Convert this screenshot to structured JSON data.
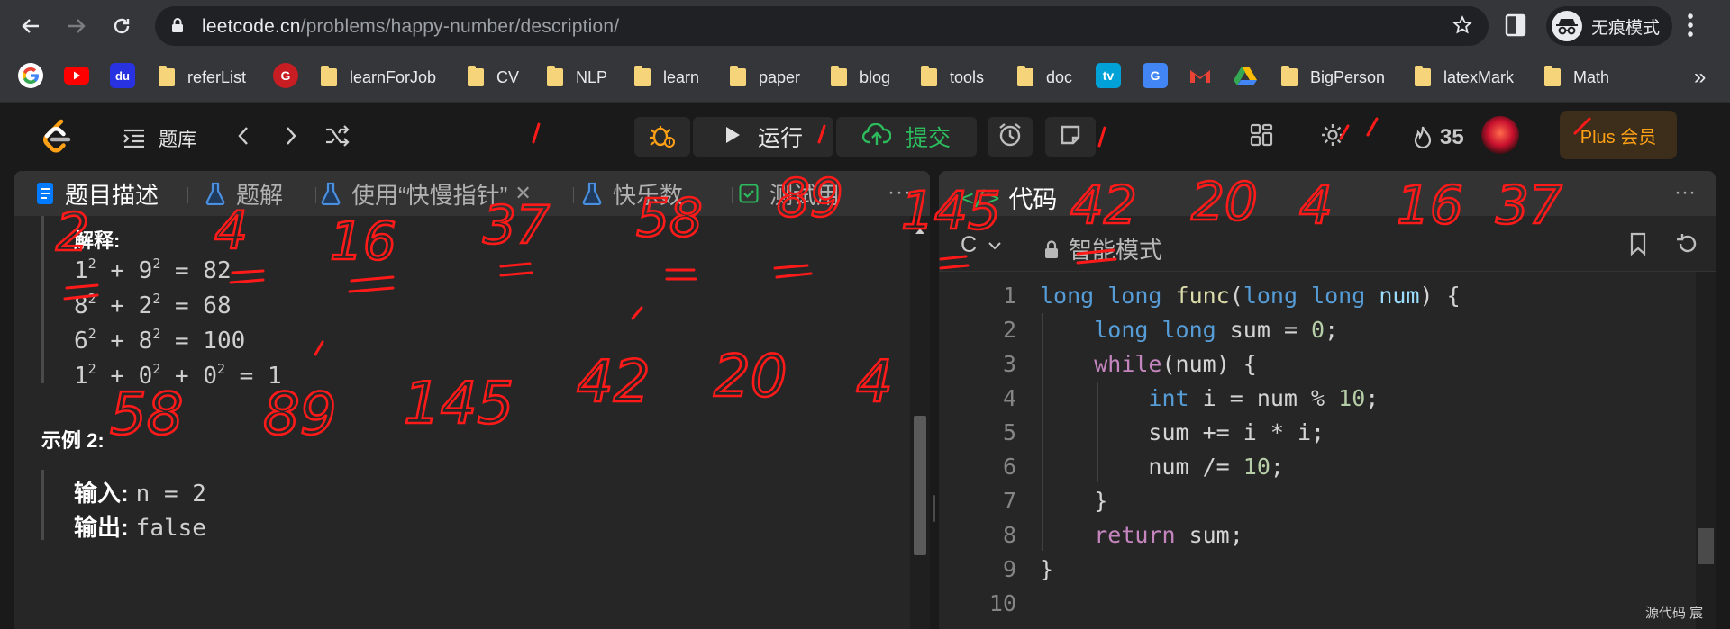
{
  "browser": {
    "url_host": "leetcode.cn",
    "url_path": "/problems/happy-number/description/",
    "profile_label": "无痕模式",
    "nav_icons": [
      "back-arrow-icon",
      "forward-arrow-icon",
      "reload-icon"
    ]
  },
  "bookmarks": [
    {
      "label": "referList"
    },
    {
      "label": "learnForJob"
    },
    {
      "label": "CV"
    },
    {
      "label": "NLP"
    },
    {
      "label": "learn"
    },
    {
      "label": "paper"
    },
    {
      "label": "blog"
    },
    {
      "label": "tools"
    },
    {
      "label": "doc"
    },
    {
      "label": "BigPerson"
    },
    {
      "label": "latexMark"
    },
    {
      "label": "Math"
    }
  ],
  "bookmarks_overflow": "»",
  "leetcode": {
    "problem_list_label": "题库",
    "run_label": "运行",
    "submit_label": "提交",
    "streak_count": "35",
    "plus_label": "Plus 会员",
    "accent_color": "#ffa116",
    "success_color": "#2cbb5d"
  },
  "left_panel": {
    "tabs": [
      {
        "label": "题目描述"
      },
      {
        "label": "题解"
      },
      {
        "label": "使用“快慢指针”"
      },
      {
        "label": "快乐数"
      },
      {
        "label": "测试用"
      }
    ],
    "more": "···",
    "explanation_title": "解释:",
    "equations": [
      {
        "a": "1",
        "b": "9",
        "rest": " = 82"
      },
      {
        "a": "8",
        "b": "2",
        "rest": " = 68"
      },
      {
        "a": "6",
        "b": "8",
        "rest": " = 100"
      }
    ],
    "last_equation": {
      "a": "1",
      "b": "0",
      "c": "0",
      "rest": " = 1"
    },
    "example_heading": "示例 2:",
    "input_key": "输入:",
    "input_value": "n = 2",
    "output_key": "输出:",
    "output_value": "false"
  },
  "right_panel": {
    "tab_label": "代码",
    "language": "C",
    "mode_label": "智能模式",
    "more": "···",
    "line_numbers": [
      "1",
      "2",
      "3",
      "4",
      "5",
      "6",
      "7",
      "8",
      "9",
      "10"
    ]
  },
  "footer_note": "源代码  宸",
  "annotations": {
    "row1": [
      "2",
      "4",
      "16",
      "37",
      "58",
      "89",
      "145",
      "42",
      "20",
      "4",
      "16",
      "37"
    ],
    "row2": [
      "58",
      "89",
      "145",
      "42",
      "20",
      "4"
    ]
  }
}
